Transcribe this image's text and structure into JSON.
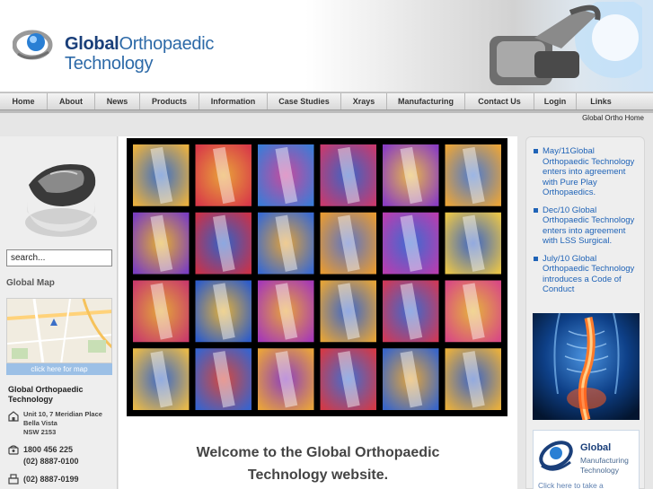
{
  "header": {
    "logo_bold": "Global",
    "logo_thin": "Orthopaedic",
    "logo_line2": "Technology"
  },
  "nav": {
    "items": [
      {
        "label": "Home"
      },
      {
        "label": "About"
      },
      {
        "label": "News"
      },
      {
        "label": "Products"
      },
      {
        "label": "Information"
      },
      {
        "label": "Case Studies"
      },
      {
        "label": "Xrays"
      },
      {
        "label": "Manufacturing"
      },
      {
        "label": "Contact Us"
      },
      {
        "label": "Login"
      },
      {
        "label": "Links"
      }
    ]
  },
  "breadcrumb": "Global Ortho Home",
  "sidebar": {
    "search_value": "search...",
    "map_title": "Global Map",
    "map_button": "click here for map",
    "company": "Global Orthopaedic Technology",
    "address_line1": "Unit 10, 7 Meridian Place",
    "address_line2": "Bella Vista",
    "address_line3": "NSW 2153",
    "phone1": "1800 456 225",
    "phone2": "(02) 8887-0100",
    "fax": "(02) 8887-0199"
  },
  "main": {
    "welcome_line1": "Welcome to the Global Orthopaedic",
    "welcome_line2": "Technology website."
  },
  "news": {
    "items": [
      "May/11Global Orthopaedic Technology enters into agreement with Pure Play Orthopaedics.",
      "Dec/10 Global Orthopaedic Technology enters into agreement with LSS Surgical.",
      "July/10 Global Orthopaedic Technology introduces a Code of Conduct"
    ]
  },
  "promo": {
    "title": "Global",
    "subtitle_line1": "Manufacturing",
    "subtitle_line2": "Technology",
    "click_text": "Click here to take a"
  },
  "colors": {
    "brand_blue": "#1a3f7a",
    "link_blue": "#1f63b7",
    "map_button": "#9cc0e6"
  }
}
